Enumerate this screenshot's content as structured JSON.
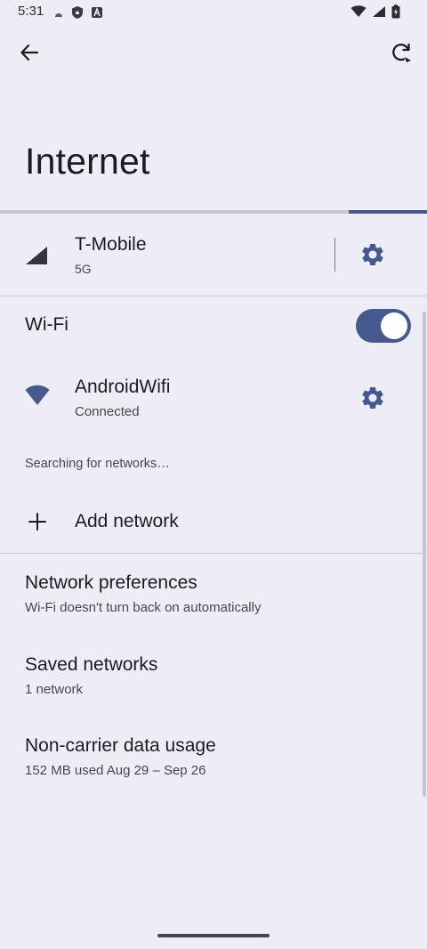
{
  "status_bar": {
    "time": "5:31",
    "left_icons": [
      "weather-icon",
      "shield-icon",
      "accessibility-a-icon"
    ],
    "right_icons": [
      "wifi-signal-icon",
      "cell-signal-icon",
      "battery-charging-icon"
    ]
  },
  "top_bar": {
    "back_icon": "back-arrow-icon",
    "refresh_icon": "refresh-icon"
  },
  "page": {
    "title": "Internet",
    "progress_fraction": 0.183
  },
  "carrier": {
    "name": "T-Mobile",
    "type": "5G",
    "icon": "cell-signal-icon",
    "settings_icon": "gear-icon"
  },
  "wifi": {
    "label": "Wi-Fi",
    "enabled": true
  },
  "connected_network": {
    "name": "AndroidWifi",
    "status": "Connected",
    "icon": "wifi-icon",
    "settings_icon": "gear-icon"
  },
  "searching_text": "Searching for networks…",
  "add_network": {
    "label": "Add network",
    "icon": "plus-icon"
  },
  "preferences": [
    {
      "title": "Network preferences",
      "subtitle": "Wi‑Fi doesn't turn back on automatically"
    },
    {
      "title": "Saved networks",
      "subtitle": "1 network"
    },
    {
      "title": "Non-carrier data usage",
      "subtitle": "152 MB used Aug 29 – Sep 26"
    }
  ],
  "colors": {
    "background": "#EEEDF6",
    "accent": "#46598F",
    "divider": "#C6C6D0",
    "secondary_text": "#45464F"
  }
}
